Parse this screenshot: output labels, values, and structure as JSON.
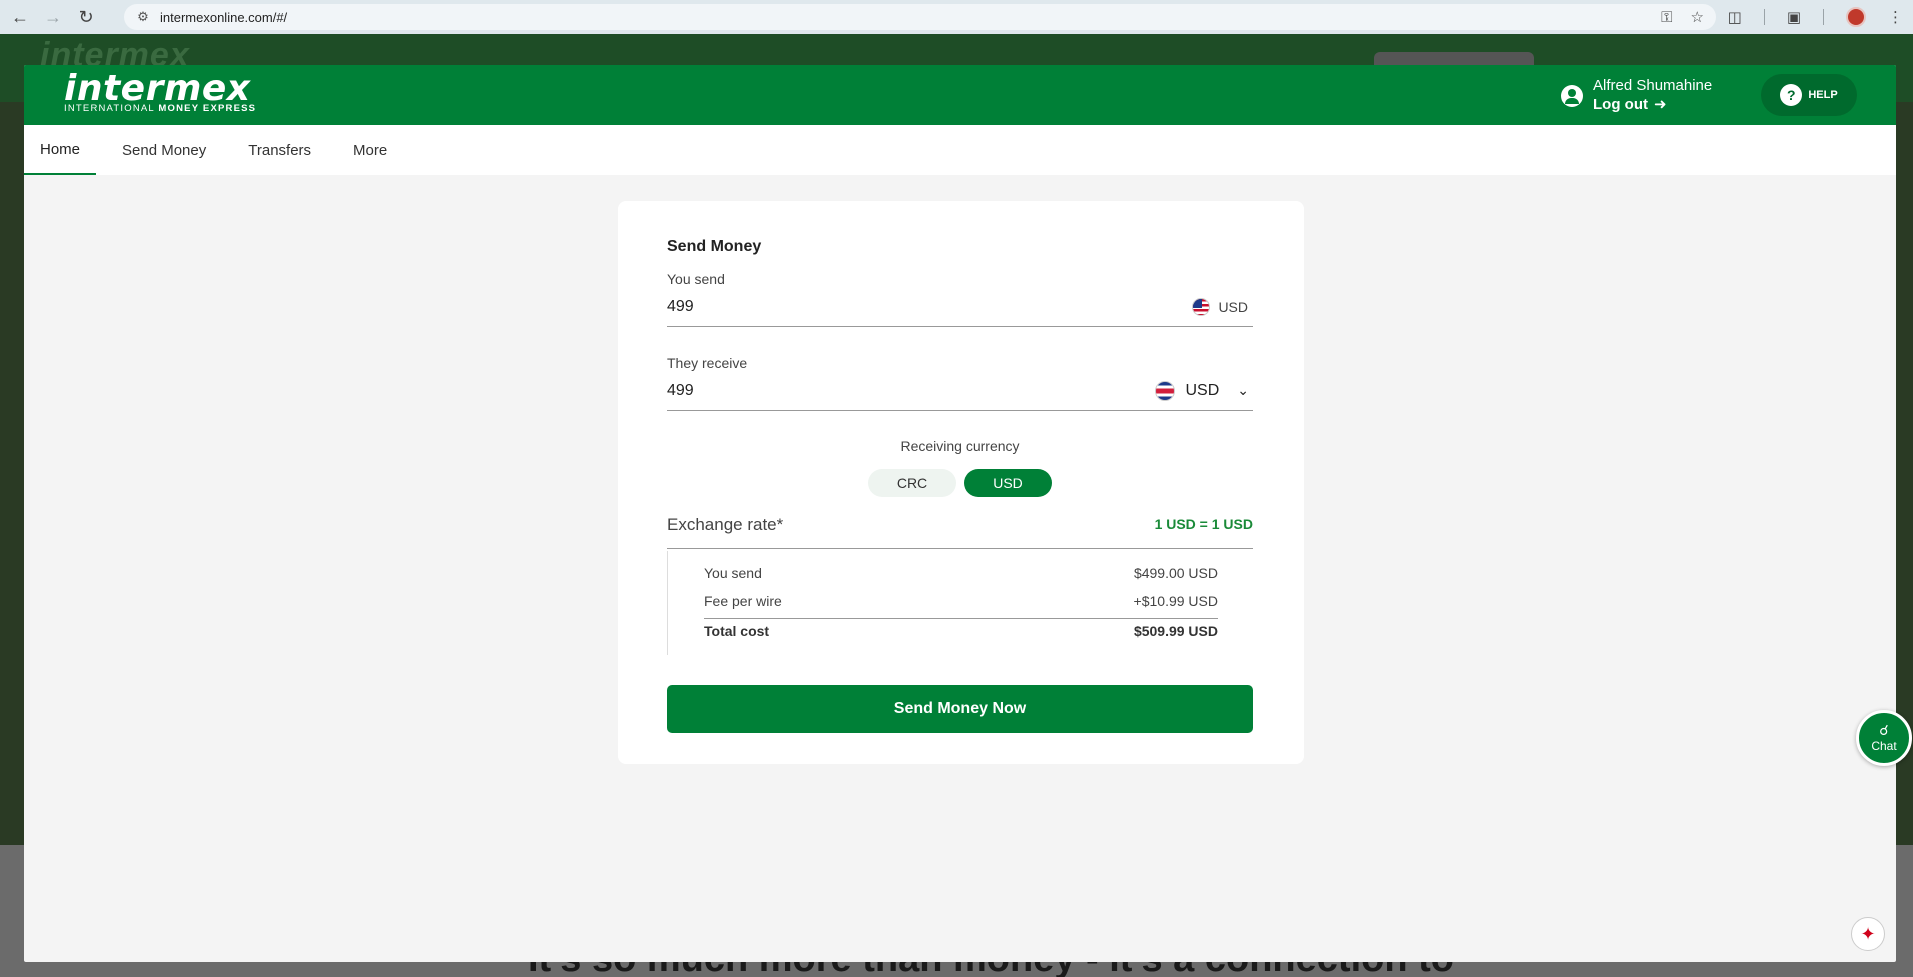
{
  "browser": {
    "url": "intermexonline.com/#/",
    "icons": [
      "back-icon",
      "forward-icon",
      "reload-icon",
      "site-info-icon",
      "password-key-icon",
      "bookmark-star-icon",
      "extensions-icon",
      "tab-search-icon",
      "profile-icon",
      "menu-icon"
    ]
  },
  "background": {
    "logo_ghost": "intermex",
    "bottom_text": "It's so much more than money - it's a connection to"
  },
  "header": {
    "logo_main": "intermex",
    "logo_sub_light": "INTERNATIONAL",
    "logo_sub_bold": "MONEY EXPRESS",
    "user_name": "Alfred Shumahine",
    "logout_label": "Log out",
    "help_label": "HELP",
    "brand_color": "#008037"
  },
  "tabs": [
    {
      "label": "Home",
      "active": true
    },
    {
      "label": "Send Money",
      "active": false
    },
    {
      "label": "Transfers",
      "active": false
    },
    {
      "label": "More",
      "active": false
    }
  ],
  "send_money": {
    "title": "Send Money",
    "you_send_label": "You send",
    "you_send_value": "499",
    "you_send_currency": "USD",
    "they_receive_label": "They receive",
    "they_receive_value": "499",
    "they_receive_currency": "USD",
    "receiving_currency_label": "Receiving currency",
    "currency_options": [
      "CRC",
      "USD"
    ],
    "selected_currency": "USD",
    "exchange_rate_label": "Exchange rate*",
    "exchange_rate_value": "1 USD = 1 USD",
    "summary": {
      "you_send_label": "You send",
      "you_send_amount": "$499.00 USD",
      "fee_label": "Fee per wire",
      "fee_amount": "+$10.99 USD",
      "total_label": "Total cost",
      "total_amount": "$509.99 USD"
    },
    "submit_label": "Send Money Now"
  },
  "floating": {
    "chat_label": "Chat"
  }
}
